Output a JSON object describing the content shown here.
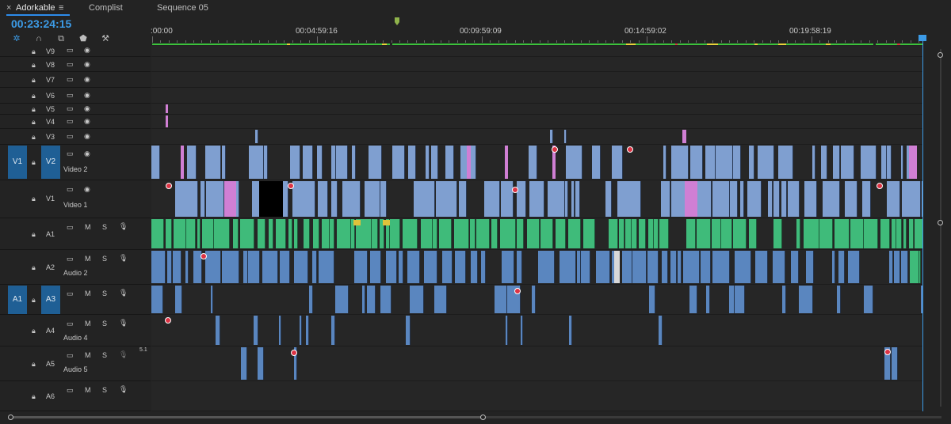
{
  "tabs": {
    "close": "×",
    "active": "Adorkable",
    "menu": "≡",
    "tab2": "Complist",
    "tab3": "Sequence 05"
  },
  "timecode": "00:23:24:15",
  "ruler": {
    "t0": ":00:00",
    "t1": "00:04:59:16",
    "t2": "00:09:59:09",
    "t3": "00:14:59:02",
    "t4": "00:19:58:19"
  },
  "tracks": {
    "v9": "V9",
    "v8": "V8",
    "v7": "V7",
    "v6": "V6",
    "v5": "V5",
    "v4": "V4",
    "v3": "V3",
    "v2": "V2",
    "v2_name": "Video 2",
    "v1": "V1",
    "v1_name": "Video 1",
    "src_v1": "V1",
    "a1": "A1",
    "a2": "A2",
    "a2_name": "Audio 2",
    "a3": "A3",
    "src_a1": "A1",
    "a4": "A4",
    "a4_name": "Audio 4",
    "a5": "A5",
    "a5_name": "Audio 5",
    "a6": "A6",
    "mute": "M",
    "solo": "S",
    "channel_label": "5.1"
  },
  "colors": {
    "accent": "#3c9be6",
    "video_clip": "#7f9fd0",
    "pink_clip": "#d07fd4",
    "audio_clip": "#5a86bf",
    "green_clip": "#3fbb7a"
  }
}
